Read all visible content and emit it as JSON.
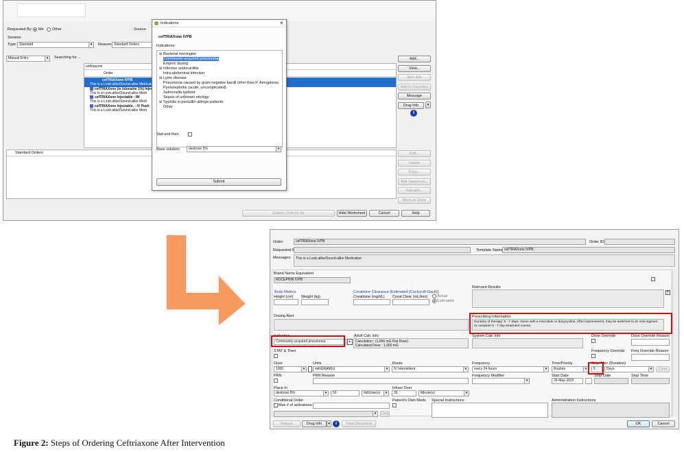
{
  "top_window": {
    "requested_by_label": "Requested By:",
    "me_label": "Me",
    "other_label": "Other",
    "source_label": "Source:",
    "session_label": "Session",
    "type_label": "Type:",
    "type_value": "Standard",
    "reason_label": "Reason:",
    "reason_value": "Standard Orders",
    "mode_value": "Manual Entry",
    "searching_label": "Searching for ...",
    "search_value": "ceftriaxone",
    "order_header": "Order",
    "results": [
      {
        "text": "cefTRIAXone  IVPB",
        "style": "sel-bold"
      },
      {
        "text": "This is a Look-alike/Sound-alike Medication",
        "style": "sel"
      },
      {
        "text": "cefTRIAXone (in lidocaine 1%) Injectable",
        "style": "bold-icon"
      },
      {
        "text": "This is a Look-alike/Sound-alike Medi",
        "style": "plain"
      },
      {
        "text": "cefTRIAXone Injectable - IM",
        "style": "bold-icon"
      },
      {
        "text": "This is a Look-alike/Sound-alike Medi",
        "style": "plain"
      },
      {
        "text": "cefTRIAXone Injectable. - IV Push",
        "style": "bold-icon"
      },
      {
        "text": "This is a Look-alike/Sound-alike Medi",
        "style": "plain"
      }
    ],
    "buttons_right": [
      "Add...",
      "View...",
      "Item Info",
      "Add to Favorites",
      "Message",
      "Drug Info"
    ],
    "buttons_right_lower": [
      "Edit...",
      "Delete",
      "Copy...",
      "Add Specimen...",
      "Indicatio...",
      "Mark as Done"
    ],
    "standard_orders_label": "Standard Orders",
    "submit_orders_label": "Submit Order(s) for",
    "hide_worksheet_label": "Hide Worksheet",
    "cancel_label": "Cancel",
    "help_label": "Help"
  },
  "indications_dialog": {
    "title": "Indications",
    "close": "×",
    "drug": "cefTRIAXone  IVPB",
    "indications_label": "Indications:",
    "items": [
      {
        "text": "Bacterial meningitis",
        "expand": true
      },
      {
        "text": "Community-acquired pneumonia",
        "selected": true
      },
      {
        "text": "Empiric dosing"
      },
      {
        "text": "Infective endocarditis",
        "expand": true
      },
      {
        "text": "Intra-abdominal infection"
      },
      {
        "text": "Lyme disease",
        "expand": true
      },
      {
        "text": "Pneumonia caused by gram-negative bacilli other than P. Aeruginosa"
      },
      {
        "text": "Pyelonephritis (acute, uncomplicated)"
      },
      {
        "text": "Salmonella typhoid"
      },
      {
        "text": "Sepsis of unknown etiology"
      },
      {
        "text": "Syphilis in penicillin-allergic patients",
        "expand": true
      },
      {
        "text": "Other"
      }
    ],
    "stat_label": "Stat and then",
    "base_solution_label": "Base solution:",
    "base_solution_value": "dextrose 5%",
    "submit_label": "Submit"
  },
  "order_form": {
    "order_label": "Order:",
    "order_value": "cefTRIAXone  IVPB",
    "order_id_label": "Order ID:",
    "requested_by_label": "Requested By:",
    "template_label": "Template Name:",
    "template_value": "cefTRIAXone  IVPB .",
    "messages_label": "Messages:",
    "messages_value": "This is a Look-alike/Sound-alike Medication",
    "brand_label": "Brand Name Equivalent",
    "brand_value": "ROCEPHIN IVPB",
    "relevant_results_label": "Relevant Results",
    "body_metrics_label": "Body Metrics",
    "height_label": "Height (cm)",
    "weight_label": "Weight (kg)",
    "creatinine_section_label": "Creatinine Clearance (Estimated (Cockcroft-Gault))",
    "creatinine_label": "Creatinine (mg/dL)",
    "creat_clear_label": "Creat Clear (mL/min)",
    "actual_label": "Actual",
    "estimated_label": "Estimated",
    "dosing_alert_label": "Dosing Alert",
    "prescribing_label": "Prescribing Information",
    "prescribing_text": "Duration of therapy:  5 - 7 days.  Given with a macrolide or doxycycline.  After improvement, may be switched to an oral regimen to complete 5 - 7 day treatment course.",
    "indication_label": "Indication",
    "indication_value": "Community-acquired pneumonia",
    "adult_calc_label": "Adult Calc Info",
    "calc_line1": "Calculation :  (1,000 mG Flat Dose)",
    "calc_line2": "Calculated Dose :  1,000 mG",
    "system_calc_label": "System Calc Info",
    "dose_override_label": "Dose Override",
    "dose_override_reason_label": "Dose Override Reason",
    "stat_then_label": "STAT & Then",
    "freq_override_label": "Frequency Override",
    "freq_override_reason_label": "Freq Override Reason",
    "dose_label": "Dose",
    "dose_value": "1000",
    "units_label": "Units",
    "units_value": "milliGRAM(s)",
    "route_label": "Route",
    "route_value": "IV Intermittent",
    "frequency_label": "Frequency",
    "frequency_value": "every 24 hours",
    "time_priority_label": "Time/Priority",
    "time_priority_value": "Routine",
    "stop_after_label": "Stop After (Duration)",
    "stop_after_value": "5",
    "stop_after_unit": "Days",
    "clear_label": "Clear",
    "prn_label": "PRN",
    "prn_reason_label": "PRN Reason",
    "freq_modifier_label": "Frequency Modifier",
    "start_date_label": "Start Date",
    "start_date_value": "26-May-2020",
    "stop_date_label": "Stop Date",
    "stop_time_label": "Stop Time",
    "place_in_label": "Place In",
    "place_in_value": "dextrose 5%",
    "place_in_amount": "50",
    "place_in_unit": "milliLiter(s)",
    "infuse_over_label": "Infuse Over",
    "infuse_over_value": "30",
    "infuse_over_unit": "Minute(s)",
    "conditional_label": "Conditional Order",
    "max_activations_label": "Max # of activations:",
    "patients_own_label": "Patient's Own Meds",
    "special_label": "Special Instructions",
    "admin_label": "Administration Instructions",
    "repeat_label": "Repeat",
    "drug_info_label": "Drug Info",
    "view_document_label": "View Document",
    "ok_label": "OK",
    "cancel_label": "Cancel"
  },
  "caption": {
    "bold": "Figure 2:",
    "text": " Steps of Ordering Ceftriaxone After Intervention"
  },
  "colors": {
    "selection": "#1f6fcf",
    "arrow": "#f79a5f",
    "highlight_box": "#d20f0f"
  }
}
